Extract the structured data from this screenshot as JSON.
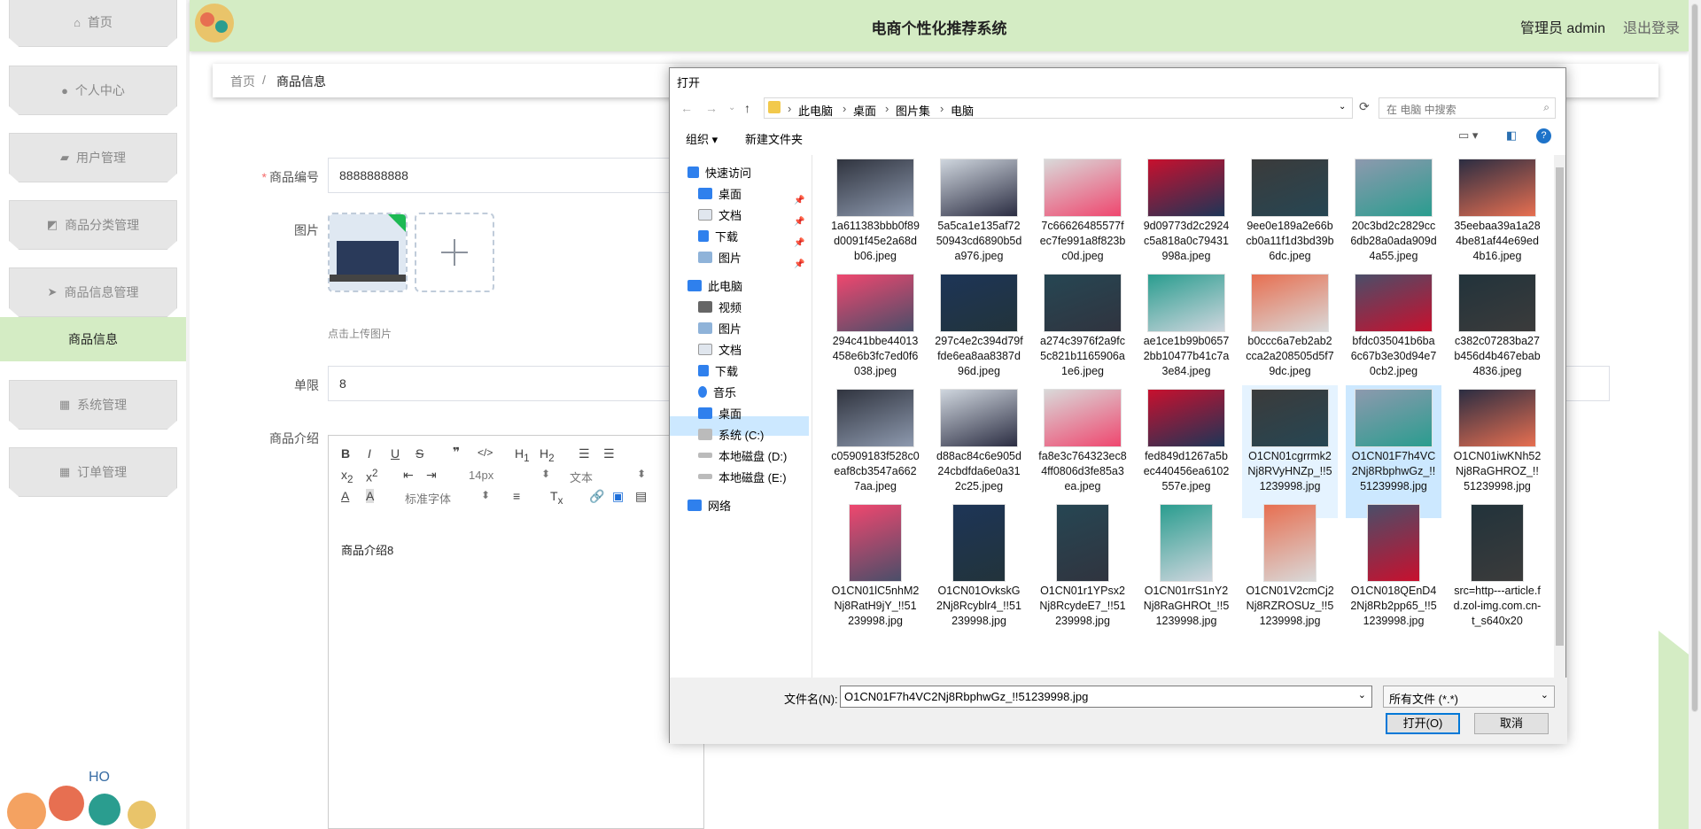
{
  "sidebar": {
    "items": [
      {
        "label": "首页",
        "icon": "home-icon"
      },
      {
        "label": "个人中心",
        "icon": "person-icon"
      },
      {
        "label": "用户管理",
        "icon": "thumb-icon"
      },
      {
        "label": "商品分类管理",
        "icon": "chart-icon"
      },
      {
        "label": "商品信息管理",
        "icon": "send-icon"
      },
      {
        "label": "系统管理",
        "icon": "grid-icon"
      },
      {
        "label": "订单管理",
        "icon": "grid-icon"
      }
    ],
    "active_sub": "商品信息"
  },
  "topbar": {
    "title": "电商个性化推荐系统",
    "user": "管理员 admin",
    "logout": "退出登录"
  },
  "breadcrumb": {
    "home": "首页",
    "sep": "/",
    "current": "商品信息"
  },
  "form": {
    "code_label": "商品编号",
    "code_value": "8888888888",
    "image_label": "图片",
    "upload_hint": "点击上传图片",
    "limit_label": "单限",
    "limit_value": "8",
    "intro_label": "商品介绍",
    "intro_text": "商品介绍8",
    "toolbar": {
      "font_size": "14px",
      "text_type": "文本",
      "font_family": "标准字体"
    }
  },
  "dialog": {
    "title": "打开",
    "path": [
      "此电脑",
      "桌面",
      "图片集",
      "电脑"
    ],
    "search_placeholder": "在 电脑 中搜索",
    "organize": "组织 ▾",
    "new_folder": "新建文件夹",
    "nav": {
      "quick_access": "快速访问",
      "quick_items": [
        "桌面",
        "文档",
        "下载",
        "图片"
      ],
      "this_pc": "此电脑",
      "pc_items": [
        "视频",
        "图片",
        "文档",
        "下载",
        "音乐",
        "桌面",
        "系统 (C:)",
        "本地磁盘 (D:)",
        "本地磁盘 (E:)"
      ],
      "network": "网络"
    },
    "files": [
      "1a611383bbb0f89d0091f45e2a68db06.jpeg",
      "5a5ca1e135af7250943cd6890b5da976.jpeg",
      "7c66626485577fec7fe991a8f823bc0d.jpeg",
      "9d09773d2c2924c5a818a0c79431998a.jpeg",
      "9ee0e189a2e66bcb0a11f1d3bd39b6dc.jpeg",
      "20c3bd2c2829cc6db28a0ada909d4a55.jpeg",
      "35eebaa39a1a284be81af44e69ed4b16.jpeg",
      "294c41bbe44013458e6b3fc7ed0f6038.jpeg",
      "297c4e2c394d79ffde6ea8aa8387d96d.jpeg",
      "a274c3976f2a9fc5c821b1165906a1e6.jpeg",
      "ae1ce1b99b06572bb10477b41c7a3e84.jpeg",
      "b0ccc6a7eb2ab2cca2a208505d5f79dc.jpeg",
      "bfdc035041b6ba6c67b3e30d94e70cb2.jpeg",
      "c382c07283ba27b456d4b467ebab4836.jpeg",
      "c05909183f528c0eaf8cb3547a6627aa.jpeg",
      "d88ac84c6e905d24cbdfda6e0a312c25.jpeg",
      "fa8e3c764323ec84ff0806d3fe85a3ea.jpeg",
      "fed849d1267a5bec440456ea6102557e.jpeg",
      "O1CN01cgrrmk2Nj8RVyHNZp_!!51239998.jpg",
      "O1CN01F7h4VC2Nj8RbphwGz_!!51239998.jpg",
      "O1CN01iwKNh52Nj8RaGHROZ_!!51239998.jpg",
      "O1CN01lC5nhM2Nj8RatH9jY_!!51239998.jpg",
      "O1CN01OvkskG2Nj8Rcyblr4_!!51239998.jpg",
      "O1CN01r1YPsx2Nj8RcydeE7_!!51239998.jpg",
      "O1CN01rrS1nY2Nj8RaGHROt_!!51239998.jpg",
      "O1CN01V2cmCj2Nj8RZROSUz_!!51239998.jpg",
      "O1CN018QEnD42Nj8Rb2pp65_!!51239998.jpg",
      "src=http---article.fd.zol-img.com.cn-t_s640x20"
    ],
    "filename_label": "文件名(N):",
    "filename_value": "O1CN01F7h4VC2Nj8RbphwGz_!!51239998.jpg",
    "filetype": "所有文件 (*.*)",
    "open_button": "打开(O)",
    "cancel_button": "取消"
  },
  "colors": {
    "accent_green": "#d4ecc4",
    "selection_blue": "#cce8ff"
  }
}
